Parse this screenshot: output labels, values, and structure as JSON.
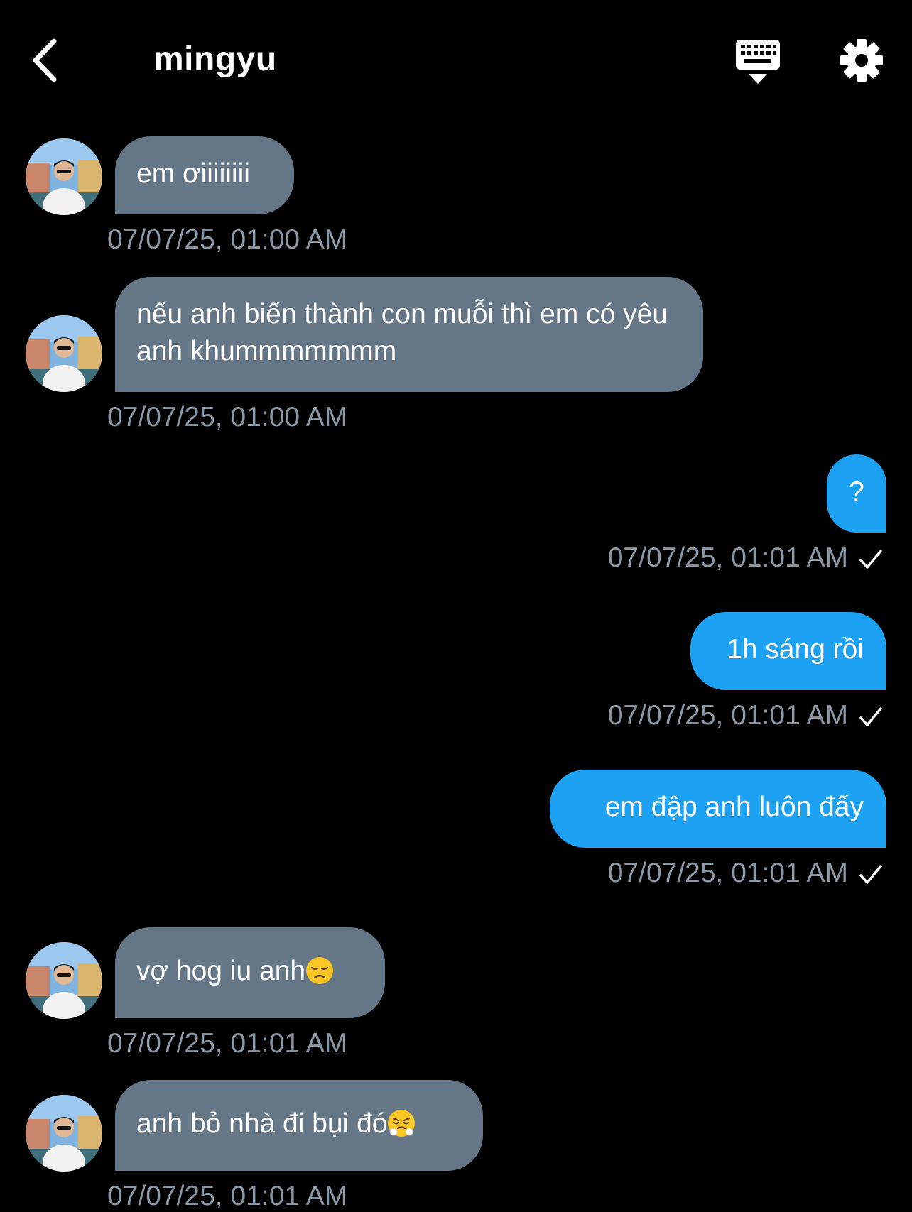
{
  "header": {
    "title": "mingyu"
  },
  "messages": [
    {
      "direction": "in",
      "text": "em ơiiiiiiii",
      "time": "07/07/25, 01:00 AM"
    },
    {
      "direction": "in",
      "text": "nếu anh biến thành con muỗi thì em có yêu anh khummmmmmm",
      "time": "07/07/25, 01:00 AM"
    },
    {
      "direction": "out",
      "text": "?",
      "time": "07/07/25, 01:01 AM",
      "read_icon": "check-icon"
    },
    {
      "direction": "out",
      "text": "1h sáng rồi",
      "time": "07/07/25, 01:01 AM",
      "read_icon": "check-icon"
    },
    {
      "direction": "out",
      "text": "em đập anh luôn đấy",
      "time": "07/07/25, 01:01 AM",
      "read_icon": "check-icon"
    },
    {
      "direction": "in",
      "text": "vợ hog iu anh",
      "emoji": "disappointed-face-emoji",
      "time": "07/07/25, 01:01 AM"
    },
    {
      "direction": "in",
      "text": "anh bỏ nhà đi bụi đó",
      "emoji": "steam-from-nose-face-emoji",
      "time": "07/07/25, 01:01 AM"
    }
  ],
  "colors": {
    "background": "#000000",
    "incoming_bubble": "#657786",
    "outgoing_bubble": "#1da1f2",
    "timestamp": "#8b98a5"
  }
}
